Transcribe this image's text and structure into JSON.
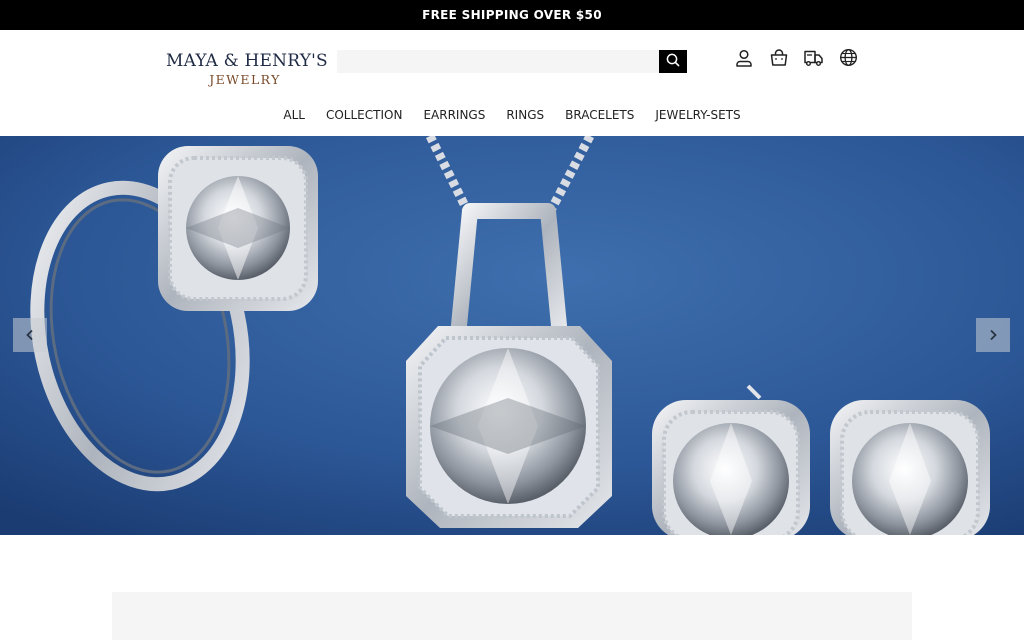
{
  "announcement": {
    "text": "FREE SHIPPING OVER $50"
  },
  "logo": {
    "line1": "MAYA & HENRY'S",
    "line2": "JEWELRY"
  },
  "search": {
    "placeholder": "",
    "value": ""
  },
  "header_icons": [
    "user-icon",
    "bag-icon",
    "truck-icon",
    "globe-icon"
  ],
  "nav": {
    "items": [
      {
        "label": "ALL"
      },
      {
        "label": "COLLECTION"
      },
      {
        "label": "EARRINGS"
      },
      {
        "label": "RINGS"
      },
      {
        "label": "BRACELETS"
      },
      {
        "label": "JEWELRY-SETS"
      }
    ]
  },
  "hero": {
    "arrow_prev": "‹",
    "arrow_next": "›"
  },
  "colors": {
    "announcement_bg": "#000000",
    "hero_bg": "#2b5590",
    "search_bg": "#f5f5f5",
    "logo_navy": "#1f2a44",
    "logo_brown": "#7a4a2a"
  }
}
